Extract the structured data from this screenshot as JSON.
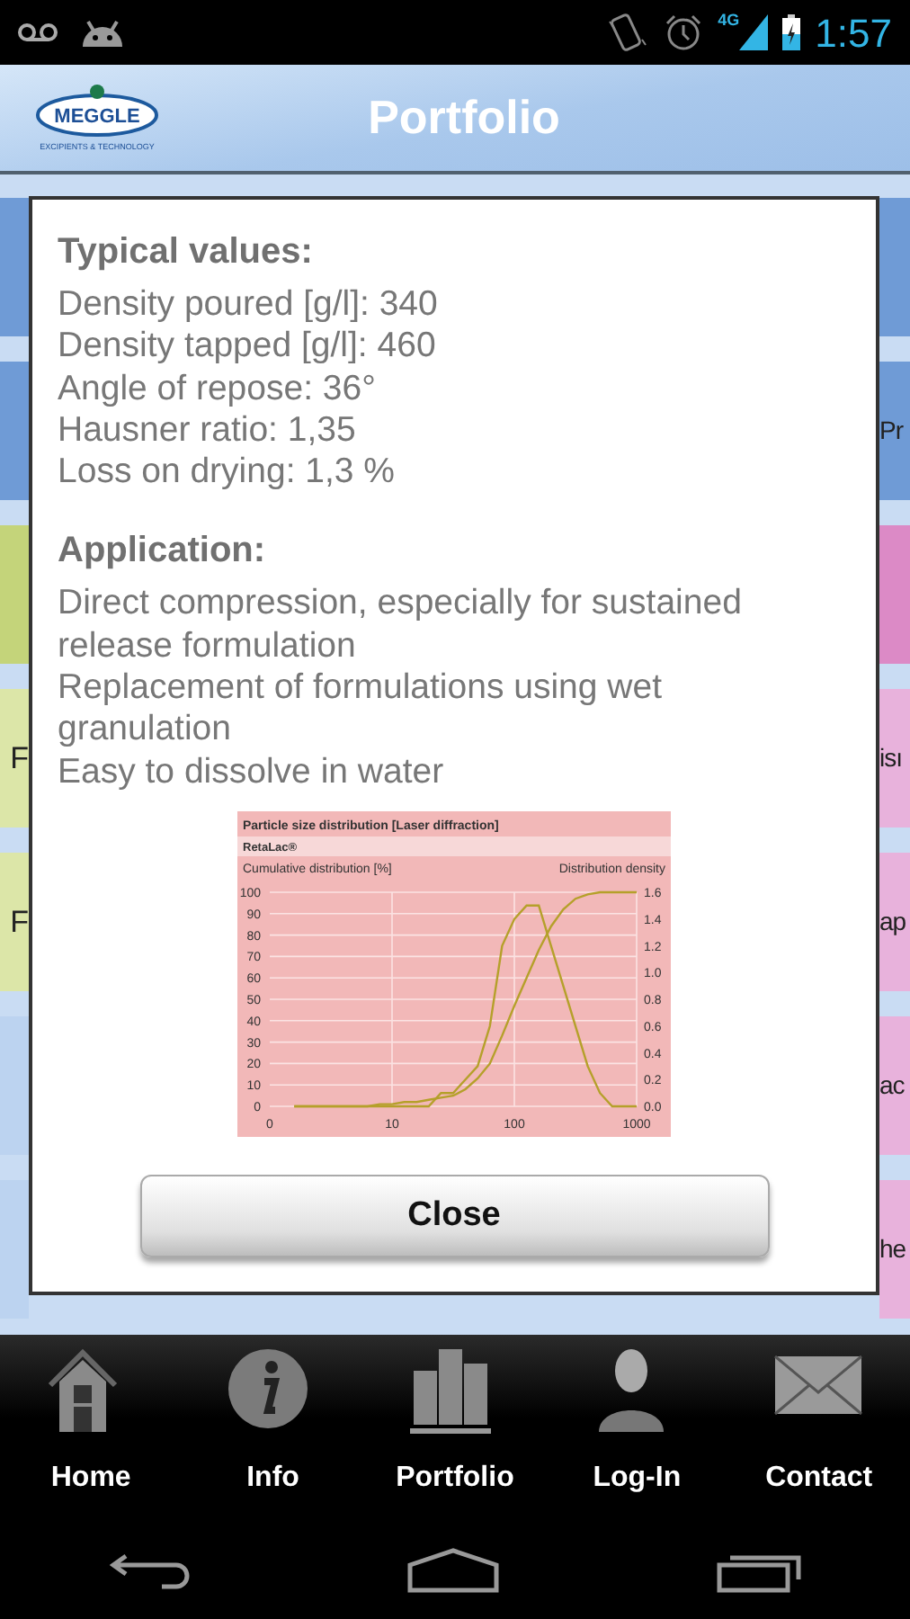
{
  "status_bar": {
    "network": "4G",
    "time": "1:57"
  },
  "header": {
    "logo_name": "MEGGLE",
    "logo_tagline": "EXCIPIENTS & TECHNOLOGY",
    "title": "Portfolio"
  },
  "background_tiles": {
    "left": [
      {
        "color": "#6f9bd6"
      },
      {
        "color": "#6f9bd6"
      },
      {
        "color": "#c4d47a"
      },
      {
        "color": "#dce6a8",
        "text": "F"
      },
      {
        "color": "#dce6a8",
        "text": "F"
      },
      {
        "color": "#bcd3f0"
      },
      {
        "color": "#bcd3f0"
      }
    ],
    "right": [
      {
        "color": "#6f9bd6"
      },
      {
        "color": "#6f9bd6",
        "text": "Pr"
      },
      {
        "color": "#dc8ac6"
      },
      {
        "color": "#e8b2dc",
        "text": "isı"
      },
      {
        "color": "#e8b2dc",
        "text": "ap"
      },
      {
        "color": "#e8b2dc",
        "text": "ac"
      },
      {
        "color": "#e8b2dc",
        "text": "he"
      }
    ]
  },
  "dialog": {
    "sections": [
      {
        "heading": "Typical values:",
        "lines": [
          "Density poured [g/l]: 340",
          "Density tapped [g/l]: 460",
          "Angle of repose: 36°",
          "Hausner ratio: 1,35",
          "Loss on drying: 1,3 %"
        ]
      },
      {
        "heading": "Application:",
        "lines": [
          "Direct compression, especially for sustained release formulation",
          "Replacement of formulations using wet granulation",
          "Easy to dissolve in water"
        ]
      }
    ],
    "chart_data": {
      "type": "line",
      "title": "Particle size distribution [Laser diffraction]",
      "subtitle": "RetaLac®",
      "ylabel": "Cumulative distribution [%]",
      "y2label": "Distribution density",
      "categories": [
        "0",
        null,
        null,
        null,
        null,
        null,
        null,
        null,
        null,
        null,
        "10",
        null,
        null,
        null,
        null,
        null,
        null,
        null,
        null,
        null,
        "100",
        null,
        null,
        null,
        null,
        null,
        null,
        null,
        null,
        null,
        "1000"
      ],
      "series": [
        {
          "color": "#b5a02a",
          "values": [
            null,
            null,
            0,
            0,
            0,
            0,
            0,
            0,
            0,
            1,
            1,
            2,
            2,
            3,
            4,
            5,
            8,
            13,
            20,
            33,
            47,
            60,
            73,
            84,
            92,
            97,
            99,
            100,
            100,
            100,
            100
          ]
        },
        {
          "color": "#b5a02a",
          "axis": "y2",
          "values": [
            null,
            null,
            0,
            0,
            0,
            0,
            0,
            0,
            0,
            0,
            0,
            0,
            0,
            0,
            0.1,
            0.1,
            0.2,
            0.3,
            0.6,
            1.2,
            1.4,
            1.5,
            1.5,
            1.2,
            0.9,
            0.6,
            0.3,
            0.1,
            0,
            0,
            0
          ]
        }
      ],
      "grid": true,
      "ylim": [
        0,
        100
      ],
      "y2lim": [
        0,
        1.6
      ],
      "yticks": [
        0,
        10,
        20,
        30,
        40,
        50,
        60,
        70,
        80,
        90,
        100
      ],
      "y2ticks": [
        {
          "value": 0,
          "label": "0.0"
        },
        {
          "value": 0.2,
          "label": "0.2"
        },
        {
          "value": 0.4,
          "label": "0.4"
        },
        {
          "value": 0.6,
          "label": "0.6"
        },
        {
          "value": 0.8,
          "label": "0.8"
        },
        {
          "value": 1,
          "label": "1.0"
        },
        {
          "value": 1.2,
          "label": "1.2"
        },
        {
          "value": 1.4,
          "label": "1.4"
        },
        {
          "value": 1.6,
          "label": "1.6"
        }
      ]
    },
    "close_button": "Close"
  },
  "tab_bar": [
    {
      "kind": "home",
      "label": "Home"
    },
    {
      "kind": "info",
      "label": "Info"
    },
    {
      "kind": "chart",
      "label": "Portfolio"
    },
    {
      "kind": "person",
      "label": "Log-In"
    },
    {
      "kind": "mail",
      "label": "Contact"
    }
  ]
}
